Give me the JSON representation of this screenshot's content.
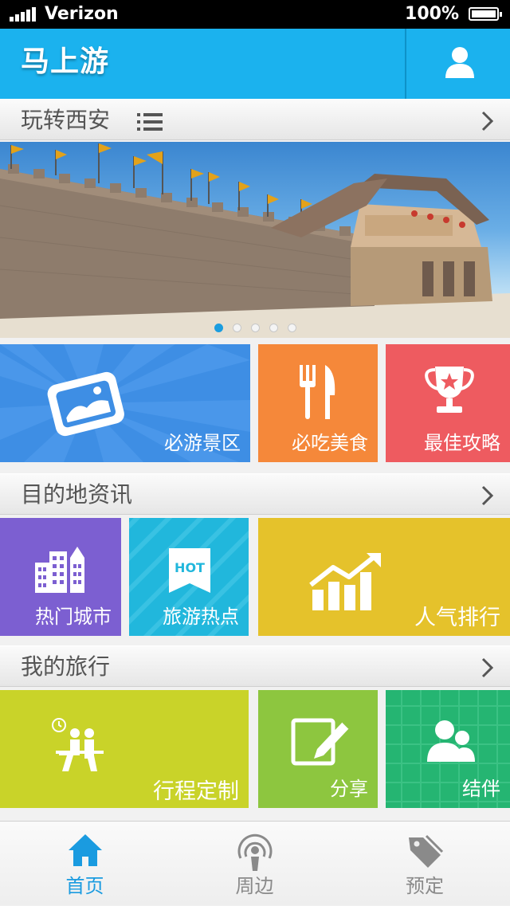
{
  "status_bar": {
    "carrier": "Verizon",
    "battery": "100%"
  },
  "header": {
    "title": "马上游",
    "user_icon": "user-icon"
  },
  "sections": {
    "explore": {
      "title": "玩转西安"
    },
    "destination_news": {
      "title": "目的地资讯"
    },
    "my_travel": {
      "title": "我的旅行"
    }
  },
  "banner": {
    "slides": 5,
    "active_index": 0
  },
  "tiles": {
    "row1": [
      {
        "label": "必游景区",
        "color": "#3e8ee4",
        "icon": "ticket-icon"
      },
      {
        "label": "必吃美食",
        "color": "#f5883a",
        "icon": "fork-knife-icon"
      },
      {
        "label": "最佳攻略",
        "color": "#ee5b60",
        "icon": "trophy-icon"
      }
    ],
    "row2": [
      {
        "label": "热门城市",
        "color": "#7c5fd1",
        "icon": "buildings-icon"
      },
      {
        "label": "旅游热点",
        "color": "#21b7dc",
        "icon": "hot-icon",
        "badge": "HOT"
      },
      {
        "label": "人气排行",
        "color": "#e5c22b",
        "icon": "trend-chart-icon"
      }
    ],
    "row3": [
      {
        "label": "行程定制",
        "color": "#c9d329",
        "icon": "travelers-icon"
      },
      {
        "label": "分享",
        "color": "#8dc63f",
        "icon": "edit-pencil-icon"
      },
      {
        "label": "结伴",
        "color": "#25b572",
        "icon": "companions-icon"
      }
    ]
  },
  "tabbar": {
    "tabs": [
      {
        "label": "首页",
        "icon": "home-icon",
        "active": true
      },
      {
        "label": "周边",
        "icon": "nearby-icon",
        "active": false
      },
      {
        "label": "预定",
        "icon": "tag-icon",
        "active": false
      }
    ],
    "active_color": "#1a9be0",
    "inactive_color": "#8a8a8a"
  }
}
